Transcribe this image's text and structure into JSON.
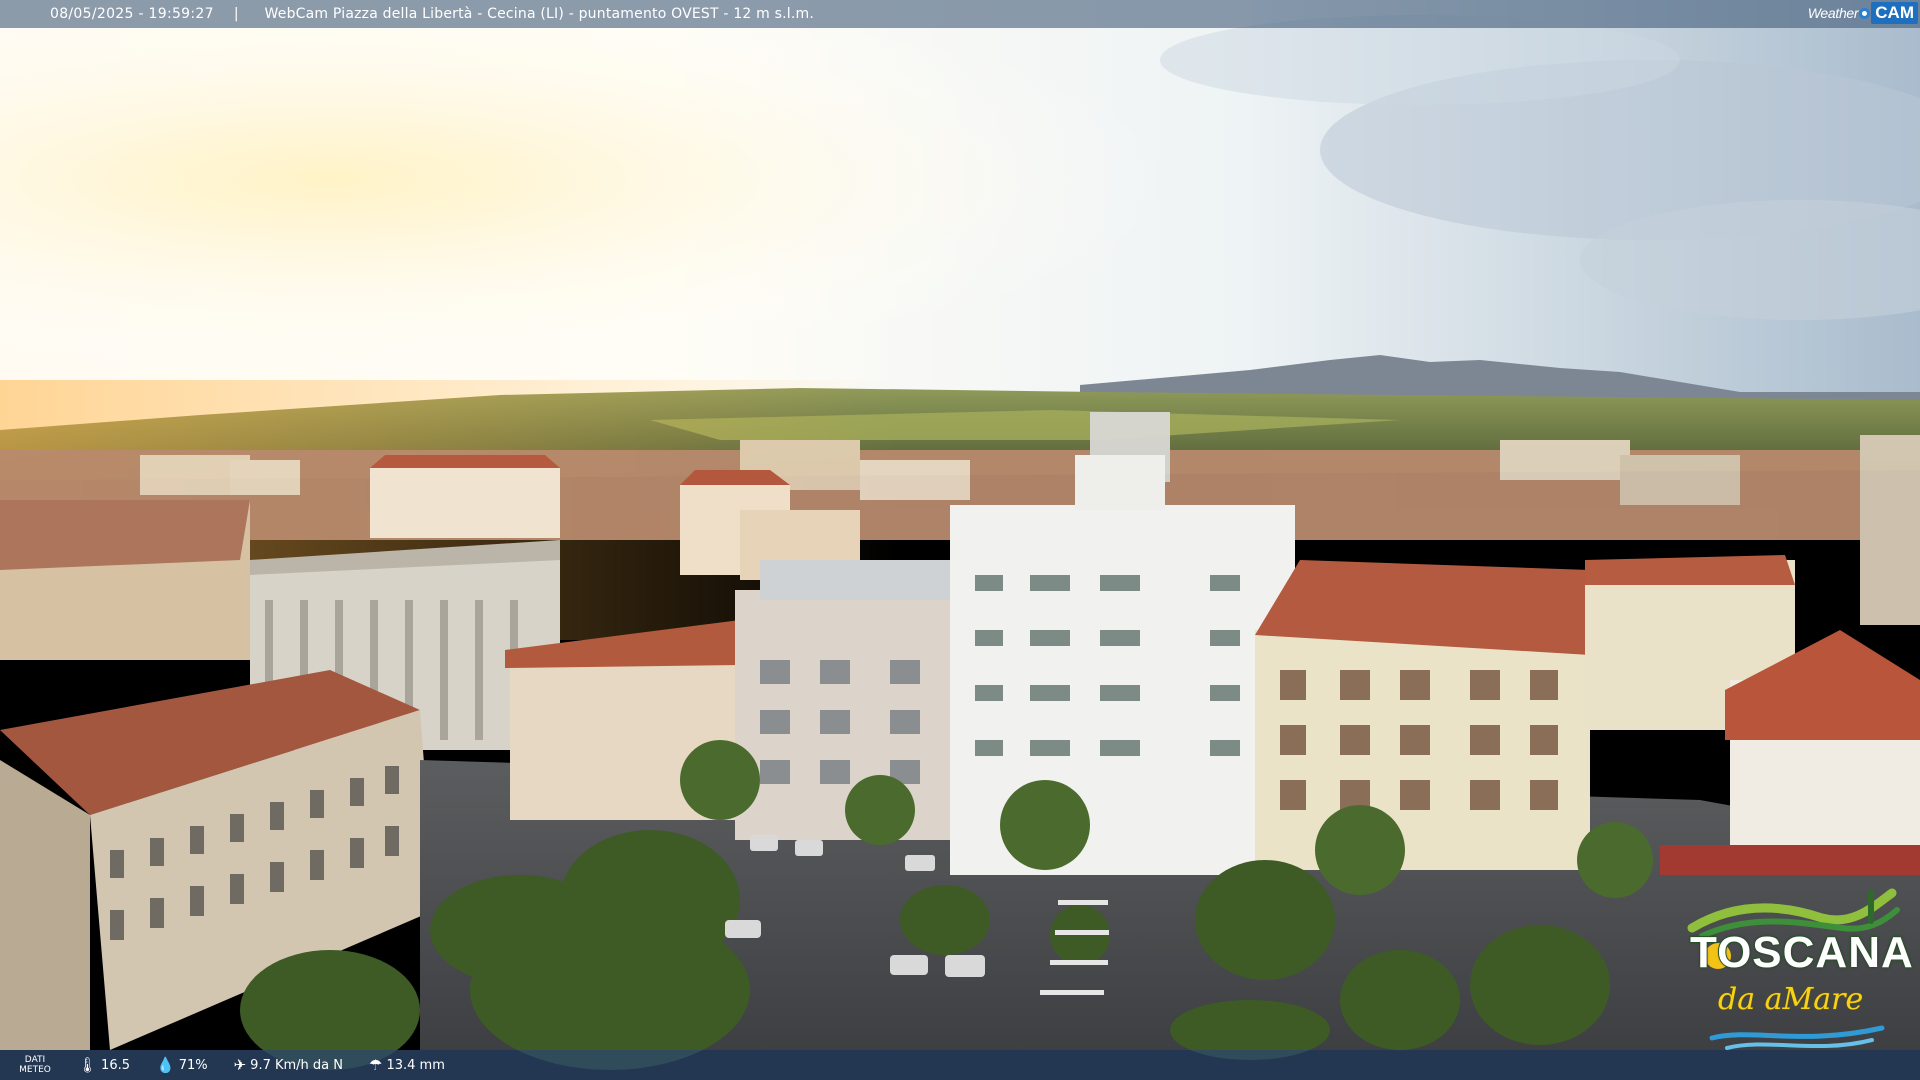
{
  "overlay": {
    "timestamp": "08/05/2025 - 19:59:27",
    "separator": "|",
    "caption": "WebCam Piazza della Libertà - Cecina (LI) - puntamento OVEST - 12 m s.l.m.",
    "brand_weather": "Weather",
    "brand_cam": "CAM"
  },
  "weather": {
    "label_line1": "DATI",
    "label_line2": "METEO",
    "temperature": "16.5",
    "humidity": "71%",
    "wind": "9.7 Km/h da N",
    "rain": "13.4 mm",
    "icons": {
      "temperature": "thermometer-icon",
      "humidity": "water-drop-icon",
      "wind": "wind-icon",
      "rain": "umbrella-icon"
    }
  },
  "logo": {
    "name": "TOSCANA",
    "tagline": "da aMare"
  },
  "colors": {
    "sky": "#dfe8ee",
    "sun": "#fff6d8",
    "roof": "#b5563b",
    "bar": "#465f7d",
    "logo_yellow": "#f7d21a",
    "logo_green": "#3e8f3a"
  }
}
